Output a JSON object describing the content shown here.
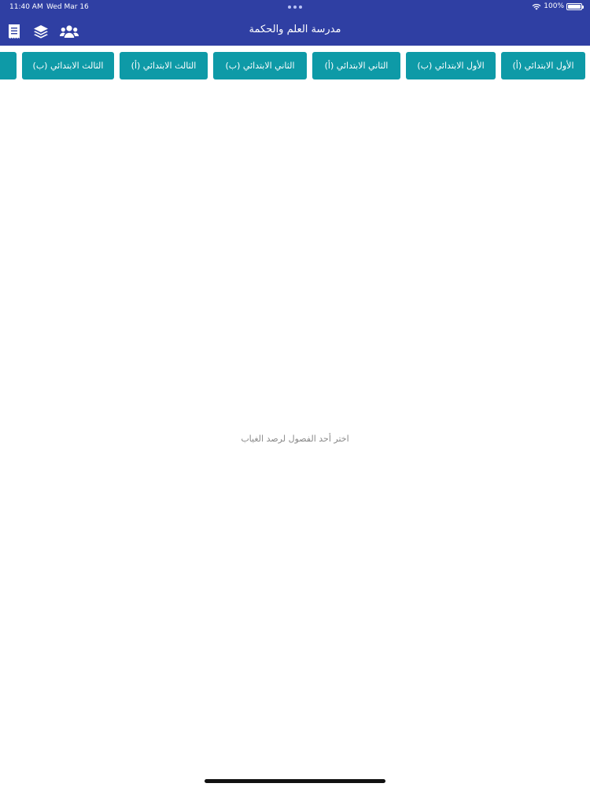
{
  "status_bar": {
    "time": "11:40 AM",
    "date": "Wed Mar 16",
    "battery_percent": "100%",
    "battery_level": 1.0
  },
  "header": {
    "title": "مدرسة العلم والحكمة",
    "icons": [
      "receipt-icon",
      "layers-icon",
      "users-icon"
    ]
  },
  "classes": [
    {
      "label": "الأول الابتدائي (أ)"
    },
    {
      "label": "الأول الابتدائي (ب)"
    },
    {
      "label": "الثاني الابتدائي (أ)"
    },
    {
      "label": "الثاني الابتدائي (ب)"
    },
    {
      "label": "الثالث الابتدائي (أ)"
    },
    {
      "label": "الثالث الابتدائي (ب)"
    }
  ],
  "empty_state": {
    "message": "اختر أحد الفصول لرصد الغياب"
  },
  "colors": {
    "header_bg": "#2f3fa3",
    "class_button_bg": "#0e9aa7",
    "message_text": "#8a8a8a"
  }
}
